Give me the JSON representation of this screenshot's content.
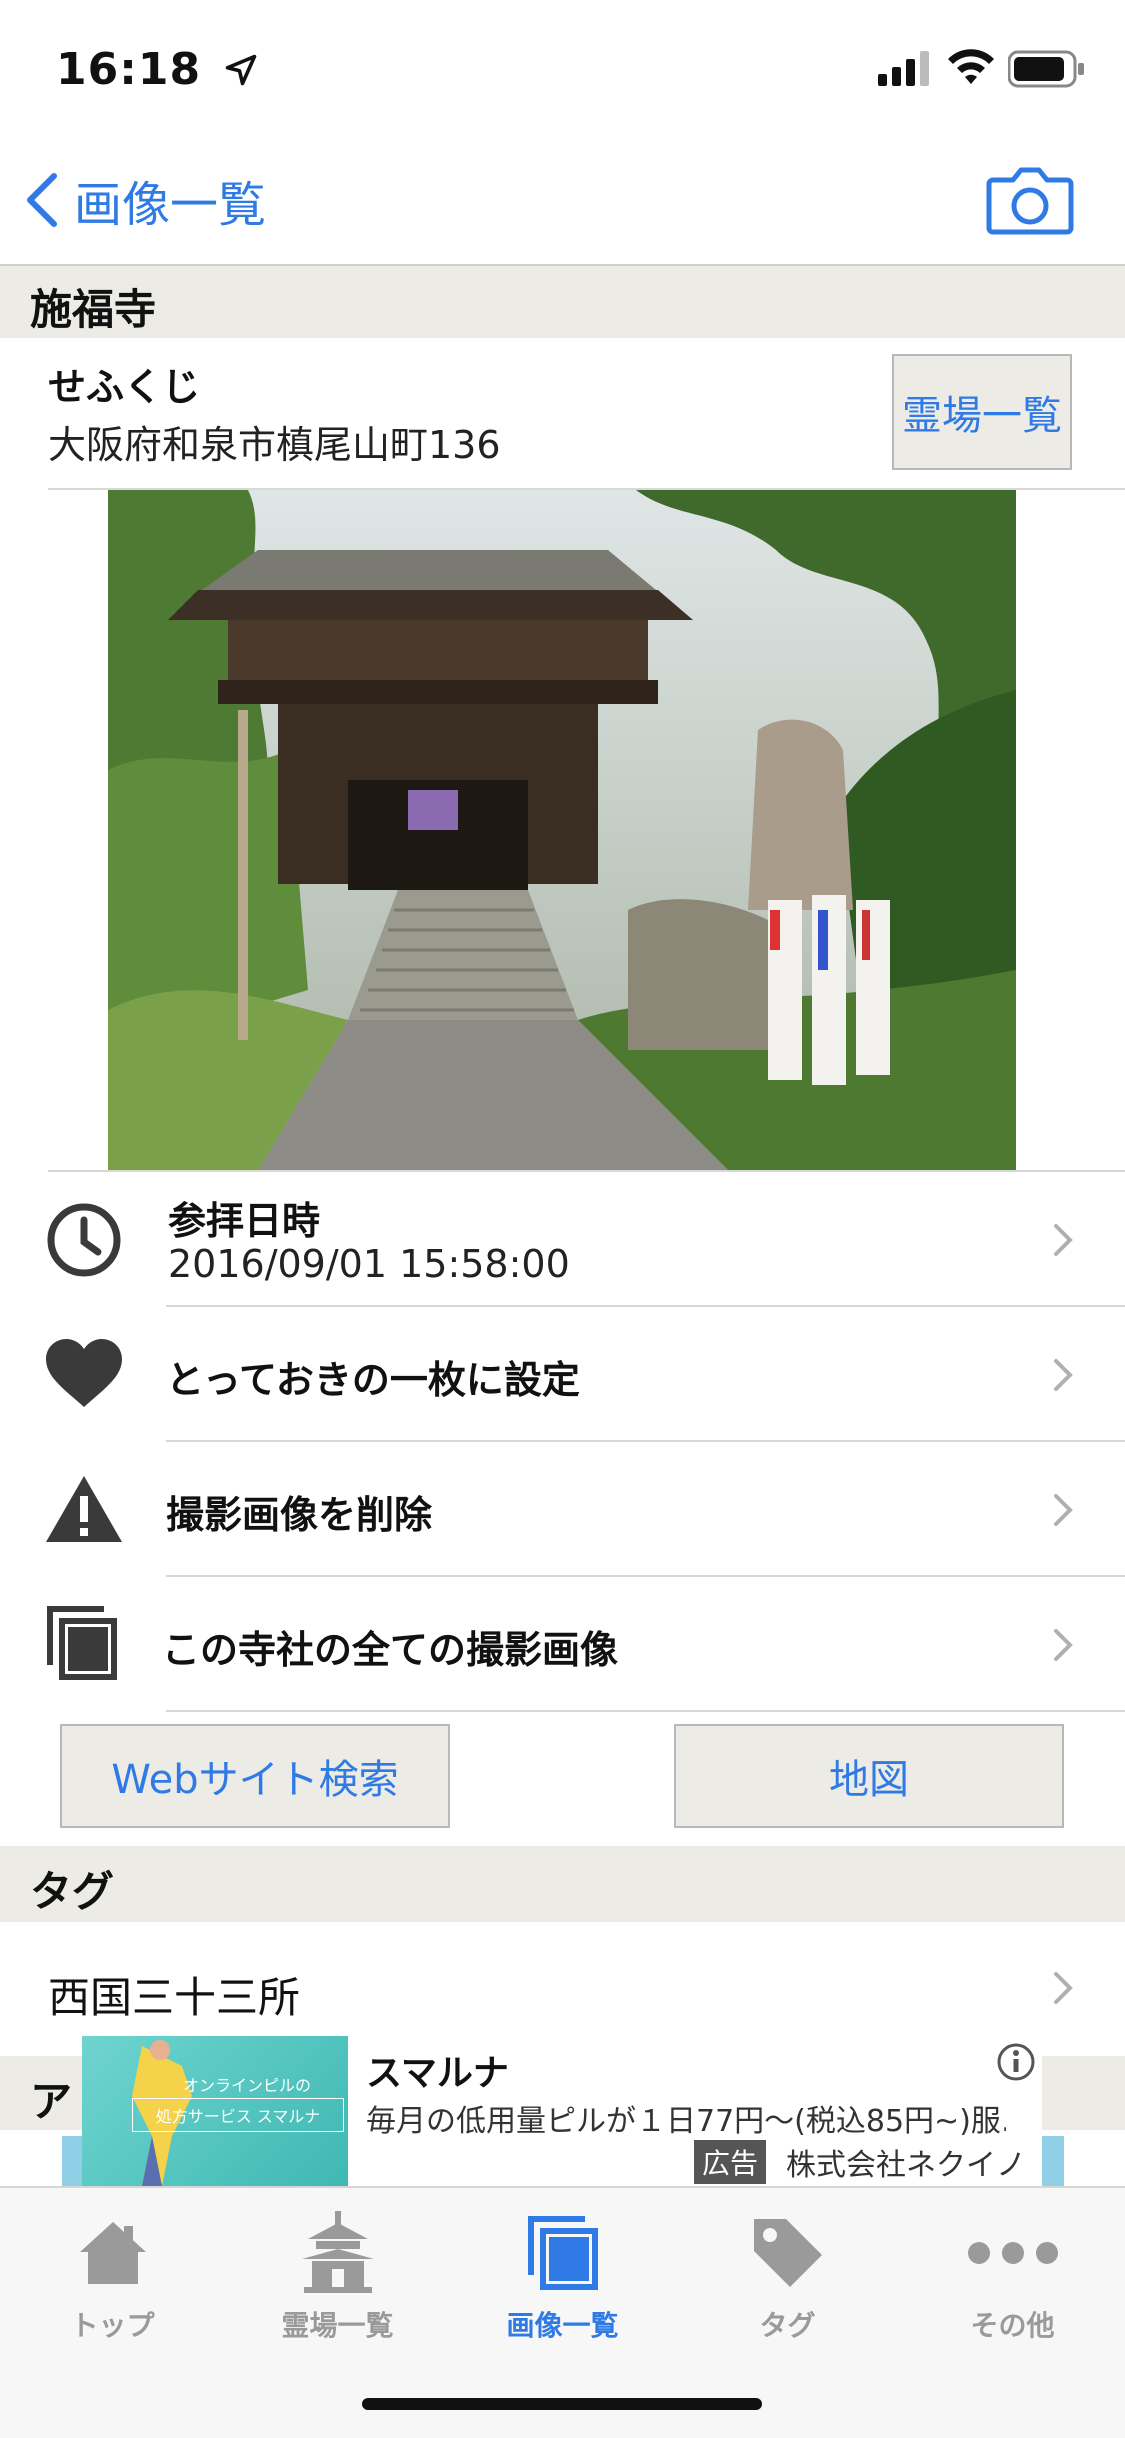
{
  "status_bar": {
    "time": "16:18"
  },
  "nav": {
    "back_label": "画像一覧"
  },
  "temple": {
    "name": "施福寺",
    "reading": "せふくじ",
    "address": "大阪府和泉市槙尾山町136",
    "list_button": "霊場一覧"
  },
  "rows": {
    "visit_label": "参拝日時",
    "visit_datetime": "2016/09/01 15:58:00",
    "favorite_label": "とっておきの一枚に設定",
    "delete_label": "撮影画像を削除",
    "all_images_label": "この寺社の全ての撮影画像"
  },
  "buttons": {
    "web_search": "Webサイト検索",
    "map": "地図"
  },
  "tags": {
    "header": "タグ",
    "items": [
      "西国三十三所"
    ]
  },
  "next_section_partial": "ア",
  "ad": {
    "image_text_1": "オンラインピルの",
    "image_text_2": "処方サービス スマルナ",
    "title": "スマルナ",
    "description": "毎月の低用量ピルが１日77円〜(税込85円~)服…",
    "badge": "広告",
    "company": "株式会社ネクイノ"
  },
  "tabbar": {
    "items": [
      {
        "label": "トップ",
        "icon": "home-icon",
        "active": false
      },
      {
        "label": "霊場一覧",
        "icon": "temple-icon",
        "active": false
      },
      {
        "label": "画像一覧",
        "icon": "images-icon",
        "active": true
      },
      {
        "label": "タグ",
        "icon": "tag-icon",
        "active": false
      },
      {
        "label": "その他",
        "icon": "more-icon",
        "active": false
      }
    ]
  },
  "colors": {
    "accent": "#2f7ae5",
    "section_bg": "#ecebe6",
    "icon_gray": "#3a3a3a"
  }
}
